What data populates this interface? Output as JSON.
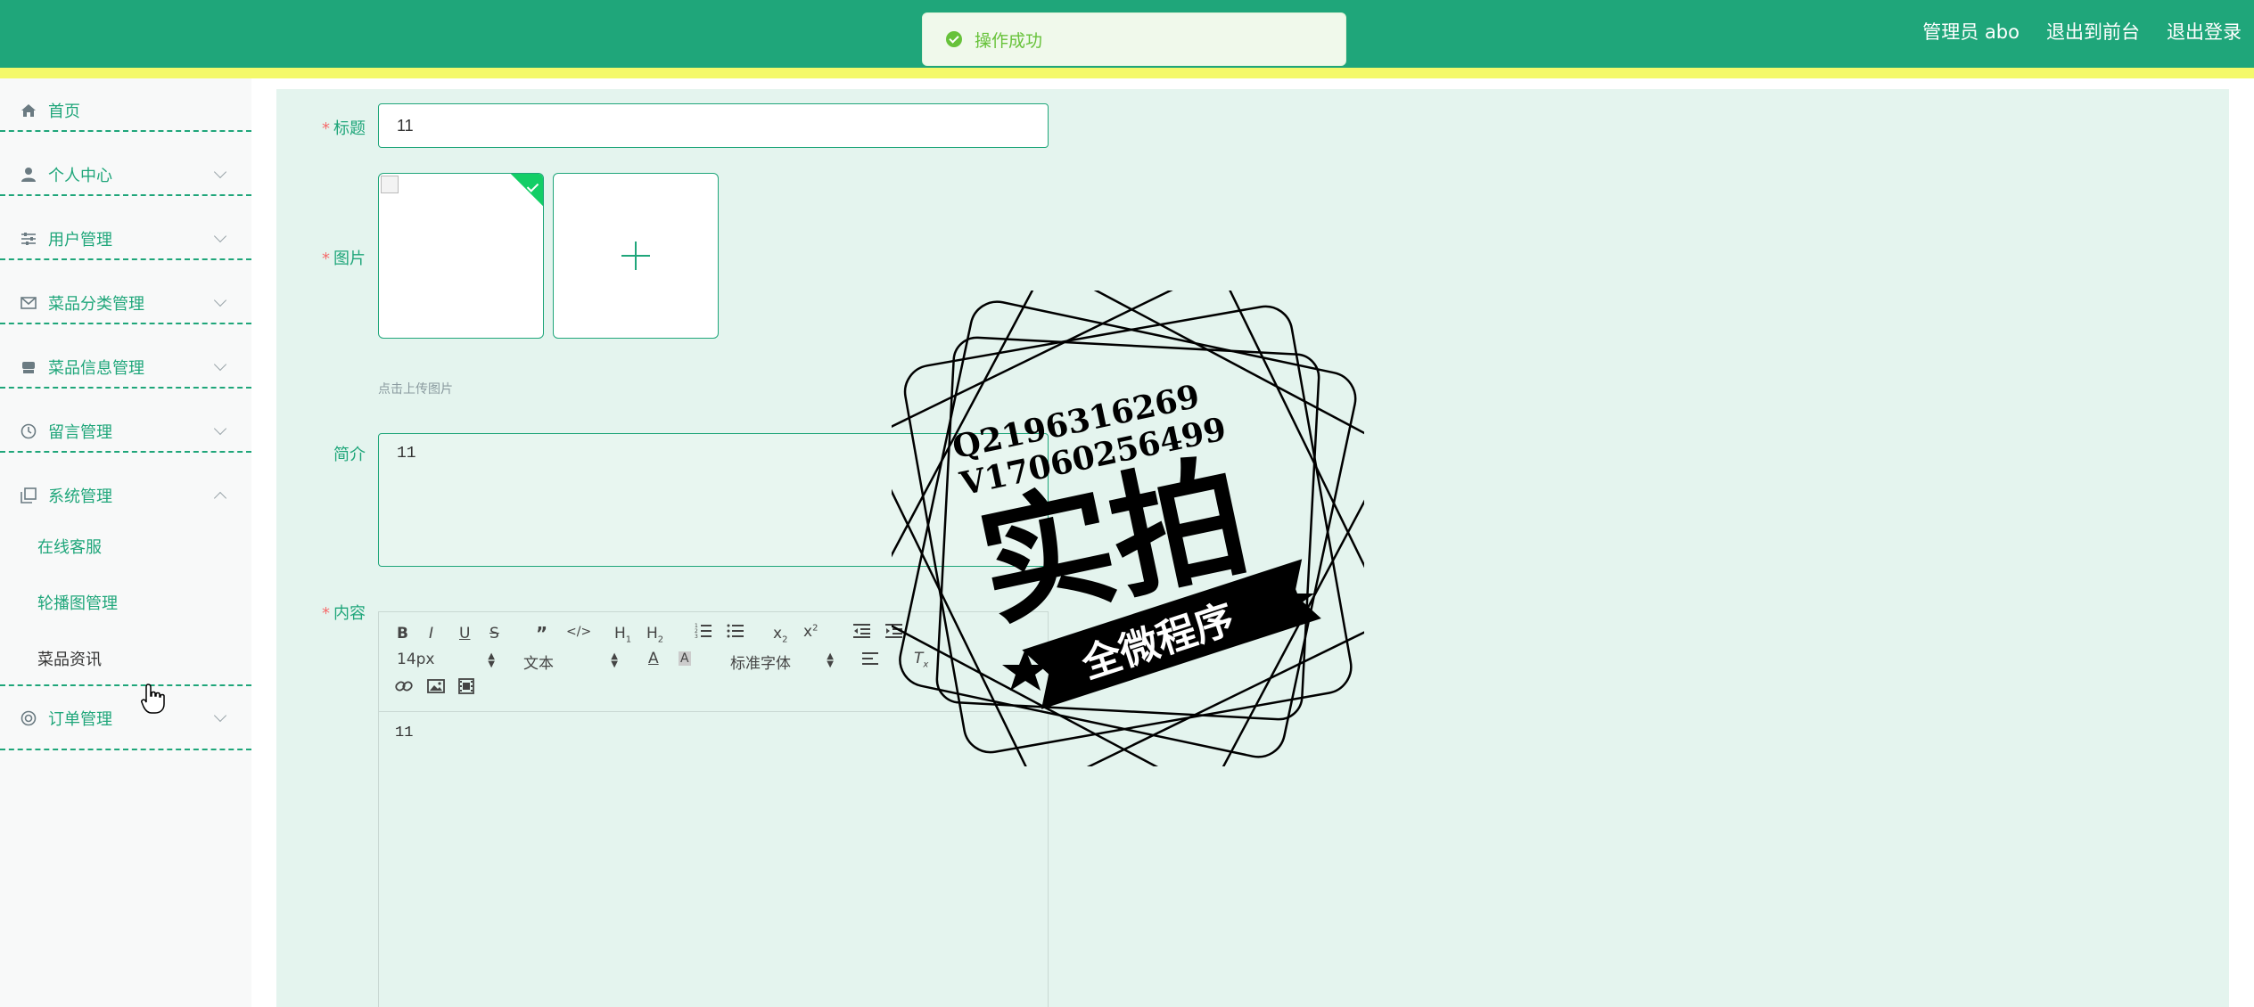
{
  "header": {
    "nav": [
      {
        "label": "管理员 abo"
      },
      {
        "label": "退出到前台"
      },
      {
        "label": "退出登录"
      }
    ]
  },
  "toast": {
    "message": "操作成功",
    "type": "success"
  },
  "sidebar": {
    "items": [
      {
        "label": "首页",
        "icon": "home-icon"
      },
      {
        "label": "个人中心",
        "icon": "user-icon"
      },
      {
        "label": "用户管理",
        "icon": "sliders-icon"
      },
      {
        "label": "菜品分类管理",
        "icon": "mail-icon"
      },
      {
        "label": "菜品信息管理",
        "icon": "shop-icon"
      },
      {
        "label": "留言管理",
        "icon": "clock-icon"
      },
      {
        "label": "系统管理",
        "icon": "copy-icon",
        "expanded": true,
        "children": [
          {
            "label": "在线客服"
          },
          {
            "label": "轮播图管理"
          },
          {
            "label": "菜品资讯",
            "active": true
          }
        ]
      },
      {
        "label": "订单管理",
        "icon": "lifebuoy-icon"
      }
    ]
  },
  "form": {
    "title_label": "标题",
    "title_value": "11",
    "image_label": "图片",
    "image_hint": "点击上传图片",
    "summary_label": "简介",
    "summary_value": "11",
    "content_label": "内容",
    "content_value": "11"
  },
  "editor": {
    "font_size": "14px",
    "paragraph": "文本",
    "font_family": "标准字体"
  },
  "watermark": {
    "line1": "Q2196316269",
    "line2": "V17060256499",
    "main": "实拍",
    "ribbon": "全微程序"
  },
  "colors": {
    "primary": "#1fa67a",
    "stripe": "#f4f96a",
    "main_bg": "#e4f4ee",
    "success": "#67c23a",
    "required": "#f56c6c"
  }
}
